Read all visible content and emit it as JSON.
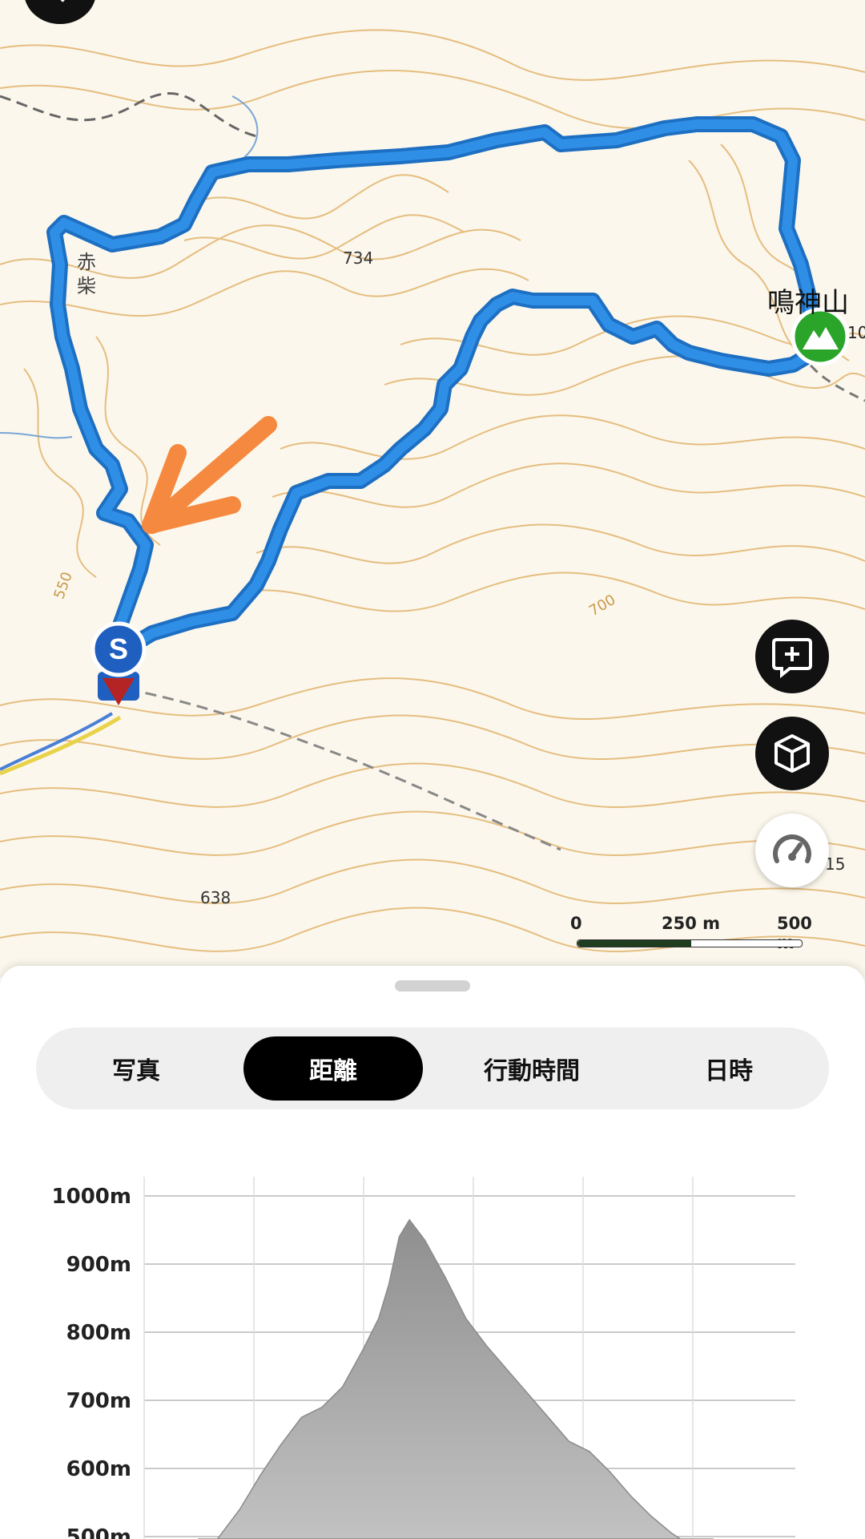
{
  "map": {
    "place_labels": {
      "akashiba": "赤\n柴",
      "peak_name": "鳴神山",
      "peak_elev_fragment": "10"
    },
    "spot_heights": [
      "734",
      "638",
      "15"
    ],
    "contour_labels": [
      "550",
      "700"
    ],
    "start_marker": "S",
    "scale": {
      "labels": [
        "0",
        "250 m",
        "500 m"
      ]
    },
    "icons": [
      "back-icon",
      "add-comment-icon",
      "3d-cube-icon",
      "speedometer-icon",
      "mountain-peak-icon"
    ],
    "colors": {
      "route": "#2f8ee6",
      "route_edge": "#1d6fc2",
      "annotation_arrow": "#f5893f",
      "contour": "#e2b46d",
      "peak_marker": "#2aa52a",
      "start_marker": "#1e5fc0"
    }
  },
  "tabs": [
    {
      "label": "写真",
      "active": false
    },
    {
      "label": "距離",
      "active": true
    },
    {
      "label": "行動時間",
      "active": false
    },
    {
      "label": "日時",
      "active": false
    }
  ],
  "chart_data": {
    "type": "area",
    "title": "",
    "xlabel": "",
    "ylabel": "",
    "y_tick_labels": [
      "1000m",
      "900m",
      "800m",
      "700m",
      "600m",
      "500m"
    ],
    "ylim": [
      500,
      1000
    ],
    "grid": true,
    "x": [
      0.0,
      0.04,
      0.08,
      0.12,
      0.16,
      0.2,
      0.24,
      0.28,
      0.32,
      0.35,
      0.37,
      0.39,
      0.41,
      0.44,
      0.48,
      0.52,
      0.56,
      0.6,
      0.64,
      0.68,
      0.72,
      0.76,
      0.8,
      0.84,
      0.88,
      0.92,
      0.96,
      1.0
    ],
    "elevation_m": [
      455,
      500,
      540,
      590,
      635,
      675,
      690,
      720,
      775,
      820,
      870,
      940,
      965,
      935,
      880,
      820,
      780,
      745,
      710,
      675,
      640,
      625,
      595,
      560,
      530,
      505,
      485,
      470
    ]
  }
}
